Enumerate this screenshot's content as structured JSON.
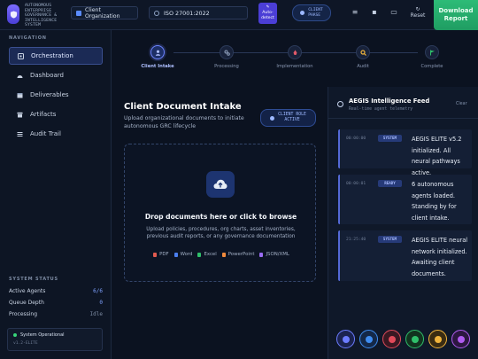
{
  "brand": {
    "lines": [
      "AUTONOMOUS",
      "ENTERPRISE",
      "GOVERNANCE &",
      "INTELLIGENCE",
      "SYSTEM"
    ]
  },
  "header": {
    "org_label": "Client Organization",
    "framework": "ISO 27001:2022",
    "auto_detect": [
      "Auto-",
      "detect"
    ],
    "phase": [
      "CLIENT",
      "PHASE"
    ],
    "reset_label": "Reset",
    "download": [
      "Download",
      "Report"
    ]
  },
  "sidebar": {
    "title": "NAVIGATION",
    "items": [
      {
        "label": "Orchestration",
        "icon": "grid-icon"
      },
      {
        "label": "Dashboard",
        "icon": "gauge-icon"
      },
      {
        "label": "Deliverables",
        "icon": "box-icon"
      },
      {
        "label": "Artifacts",
        "icon": "archive-icon"
      },
      {
        "label": "Audit Trail",
        "icon": "list-icon"
      }
    ],
    "status_title": "SYSTEM STATUS",
    "status": [
      {
        "label": "Active Agents",
        "value": "6/6"
      },
      {
        "label": "Queue Depth",
        "value": "0"
      },
      {
        "label": "Processing",
        "value": "Idle"
      }
    ],
    "card": {
      "status": "System Operational",
      "version": "v1.2-ELITE"
    }
  },
  "stepper": {
    "steps": [
      {
        "label": "Client Intake",
        "active": true
      },
      {
        "label": "Processing",
        "active": false
      },
      {
        "label": "Implementation",
        "active": false
      },
      {
        "label": "Audit",
        "active": false
      },
      {
        "label": "Complete",
        "active": false
      }
    ]
  },
  "intake": {
    "title": "Client Document Intake",
    "subtitle": "Upload organizational documents to initiate autonomous GRC lifecycle",
    "role_chip": [
      "CLIENT ROLE",
      "ACTIVE"
    ],
    "drop_title": "Drop documents here or click to browse",
    "drop_sub": "Upload policies, procedures, org charts, asset inventories, previous audit reports, or any governance documentation",
    "file_types": [
      {
        "label": "PDF",
        "color": "#e05a4f"
      },
      {
        "label": "Word",
        "color": "#4b7ff0"
      },
      {
        "label": "Excel",
        "color": "#2fbf6a"
      },
      {
        "label": "PowerPoint",
        "color": "#f08a3c"
      },
      {
        "label": "JSON/XML",
        "color": "#9a6cf2"
      }
    ]
  },
  "feed": {
    "title": "AEGIS Intelligence Feed",
    "subtitle": "Real-time agent telemetry",
    "clear_label": "Clear",
    "messages": [
      {
        "time": "00:00:00",
        "badge": "SYSTEM",
        "text": "AEGIS ELITE v5.2 initialized. All neural pathways active."
      },
      {
        "time": "00:00:01",
        "badge": "READY",
        "text": "6 autonomous agents loaded. Standing by for client intake."
      },
      {
        "time": "21:25:40",
        "badge": "SYSTEM",
        "text": "AEGIS ELITE neural network initialized. Awaiting client documents."
      }
    ],
    "agents": [
      {
        "name": "crown-agent-icon",
        "color": "#6c7cff"
      },
      {
        "name": "brain-agent-icon",
        "color": "#3f8cf0"
      },
      {
        "name": "shield-agent-icon",
        "color": "#e04a5a"
      },
      {
        "name": "scale-agent-icon",
        "color": "#2fbf6a"
      },
      {
        "name": "document-agent-icon",
        "color": "#f0b43c"
      },
      {
        "name": "chart-agent-icon",
        "color": "#b05cf0"
      }
    ]
  }
}
